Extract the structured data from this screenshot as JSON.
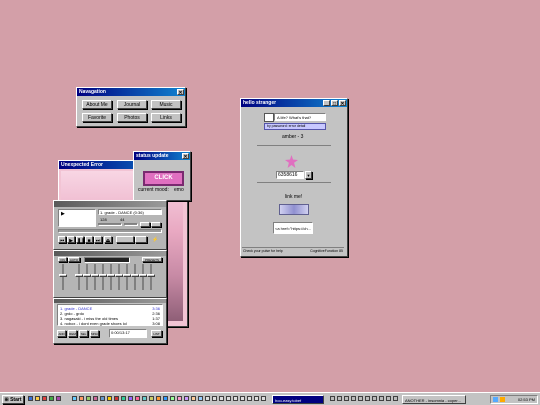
{
  "navigation": {
    "title": "Navagation",
    "close": "✕",
    "buttons": [
      "About Me",
      "Journal",
      "Music",
      "Favorite",
      "Photos",
      "Links"
    ]
  },
  "status": {
    "title": "status update",
    "close": "✕",
    "click_label": "CLICK",
    "mood_label": "current mood:",
    "mood_value": "emo"
  },
  "error": {
    "title": "Unexpected Error"
  },
  "player": {
    "track": "1. grade - DANCE  (0:36)",
    "bitrate": "128",
    "khz": "44",
    "time": "0:36",
    "eq_on": "ON",
    "eq_auto": "AUTO",
    "eq_presets": "PRESETS",
    "preamp": "PREAMP"
  },
  "playlist": {
    "items": [
      {
        "text": "1. grade - DANCE",
        "time": "3:36"
      },
      {
        "text": "2. grdo - grdo",
        "time": "2:36"
      },
      {
        "text": "3. nagasaki - i miss the old times",
        "time": "1:37"
      },
      {
        "text": "4. nobox - i dont even grade shoes lol",
        "time": "3:08"
      }
    ],
    "counter": "0:00/13:17",
    "buttons": [
      "ADD",
      "REM",
      "SEL",
      "MISC",
      "LIST"
    ]
  },
  "hello": {
    "title": "hello stranger",
    "chat_text": "A life? What's that?",
    "chat_sub": "by password: error detail",
    "name": "amber - 3",
    "counter": "6358616",
    "link_label": "link me!",
    "code": "<a href=\"https://ch...",
    "status_left": "Check your pulse for help",
    "status_right": "CognitiveFunction 85",
    "controls": [
      "_",
      "□",
      "✕"
    ]
  },
  "taskbar": {
    "start": "Start",
    "tasks": [
      "hoo-easy.tobef",
      "ANOTHER - insomnia - coper..."
    ],
    "clock": "02:53 PM"
  },
  "colors": {
    "desktop": "#d39fa8",
    "titlebar": "#000080",
    "face": "#c3c3c3",
    "click_accent": "#e070c0"
  }
}
